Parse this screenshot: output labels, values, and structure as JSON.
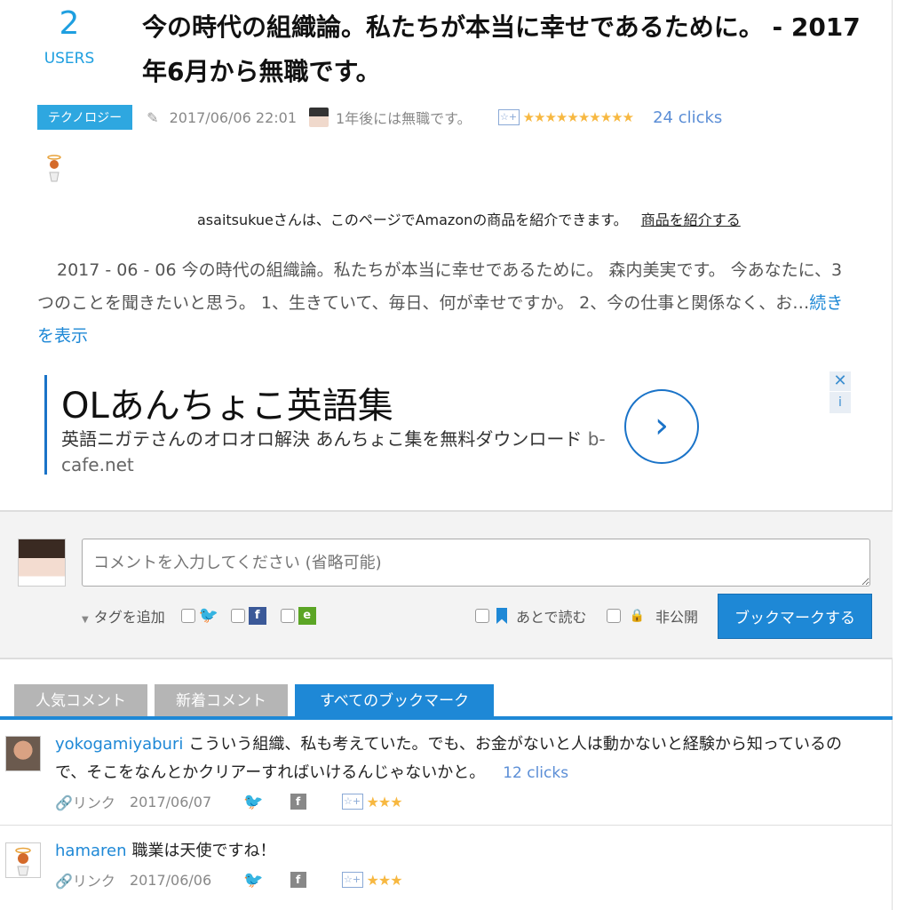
{
  "entry": {
    "users_count": "2",
    "users_label": "USERS",
    "title": "今の時代の組織論。私たちが本当に幸せであるために。 - 2017年6月から無職です。",
    "category": "テクノロジー",
    "date": "2017/06/06 22:01",
    "author": "1年後には無職です。",
    "stars": "★★★★★★★★★★",
    "clicks": "24 clicks"
  },
  "amazon": {
    "text": "asaitsukueさんは、このページでAmazonの商品を紹介できます。",
    "link": "商品を紹介する"
  },
  "summary": {
    "text": "2017 - 06 - 06 今の時代の組織論。私たちが本当に幸せであるために。 森内美実です。 今あなたに、3つのことを聞きたいと思う。 1、生きていて、毎日、何が幸せですか。 2、今の仕事と関係なく、お…",
    "more": "続きを表示"
  },
  "ad": {
    "title": "OLあんちょこ英語集",
    "desc": "英語ニガテさんのオロオロ解決 あんちょこ集を無料ダウンロード",
    "url": "b-cafe.net",
    "go": "›",
    "close": "✕",
    "info": "i"
  },
  "form": {
    "placeholder": "コメントを入力してください (省略可能)",
    "tag_add": "タグを追加",
    "read_later": "あとで読む",
    "private": "非公開",
    "submit": "ブックマークする"
  },
  "tabs": [
    {
      "label": "人気コメント"
    },
    {
      "label": "新着コメント"
    },
    {
      "label": "すべてのブックマーク"
    }
  ],
  "comments": [
    {
      "user": "yokogamiyaburi",
      "text": "こういう組織、私も考えていた。でも、お金がないと人は動かないと経験から知っているので、そこをなんとかクリアーすればいけるんじゃないかと。",
      "clicks": "12 clicks",
      "link_label": "リンク",
      "date": "2017/06/07",
      "stars": "★★★"
    },
    {
      "user": "hamaren",
      "text": "職業は天使ですね！",
      "link_label": "リンク",
      "date": "2017/06/06",
      "stars": "★★★"
    }
  ]
}
